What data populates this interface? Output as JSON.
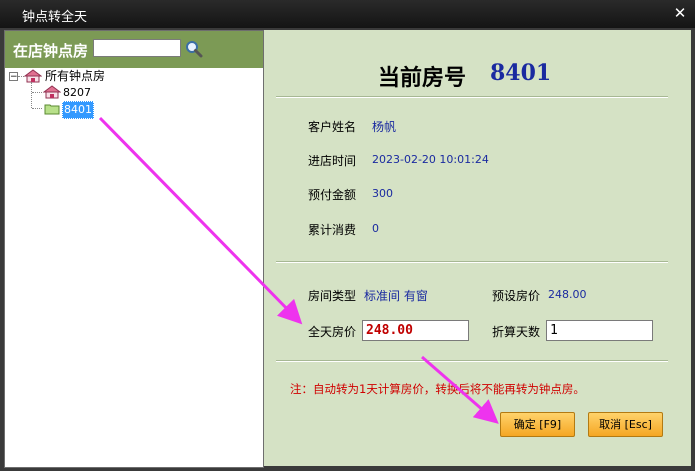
{
  "window": {
    "title": "钟点转全天",
    "close_glyph": "✕"
  },
  "left_panel": {
    "header_label": "在店钟点房",
    "search": {
      "value": "",
      "placeholder": ""
    },
    "tree": {
      "expander_glyph": "⊟",
      "root": {
        "label": "所有钟点房",
        "icon": "house-icon"
      },
      "children": [
        {
          "label": "8207",
          "icon": "house-icon",
          "selected": false
        },
        {
          "label": "8401",
          "icon": "folder-icon",
          "selected": true
        }
      ]
    }
  },
  "detail": {
    "heading_label": "当前房号",
    "room_number": "8401",
    "fields": [
      {
        "label": "客户姓名",
        "value": "杨帆"
      },
      {
        "label": "进店时间",
        "value": "2023-02-20 10:01:24"
      },
      {
        "label": "预付金额",
        "value": "300"
      },
      {
        "label": "累计消费",
        "value": "0"
      }
    ],
    "room_type_label": "房间类型",
    "room_type_value": "标准间 有窗",
    "preset_price_label": "预设房价",
    "preset_price_value": "248.00",
    "full_day_price_label": "全天房价",
    "full_day_price_value": "248.00",
    "days_label": "折算天数",
    "days_value": "1",
    "note": "注：自动转为1天计算房价，转换后将不能再转为钟点房。"
  },
  "buttons": {
    "confirm": "确定 [F9]",
    "cancel": "取消 [Esc]"
  },
  "colors": {
    "header_green": "#7c9a55",
    "panel_green": "#d5e2c5",
    "value_blue": "#1a2aa0",
    "price_red": "#c00000",
    "button_orange": "#f5a623",
    "annotation_magenta": "#ee33ee"
  }
}
